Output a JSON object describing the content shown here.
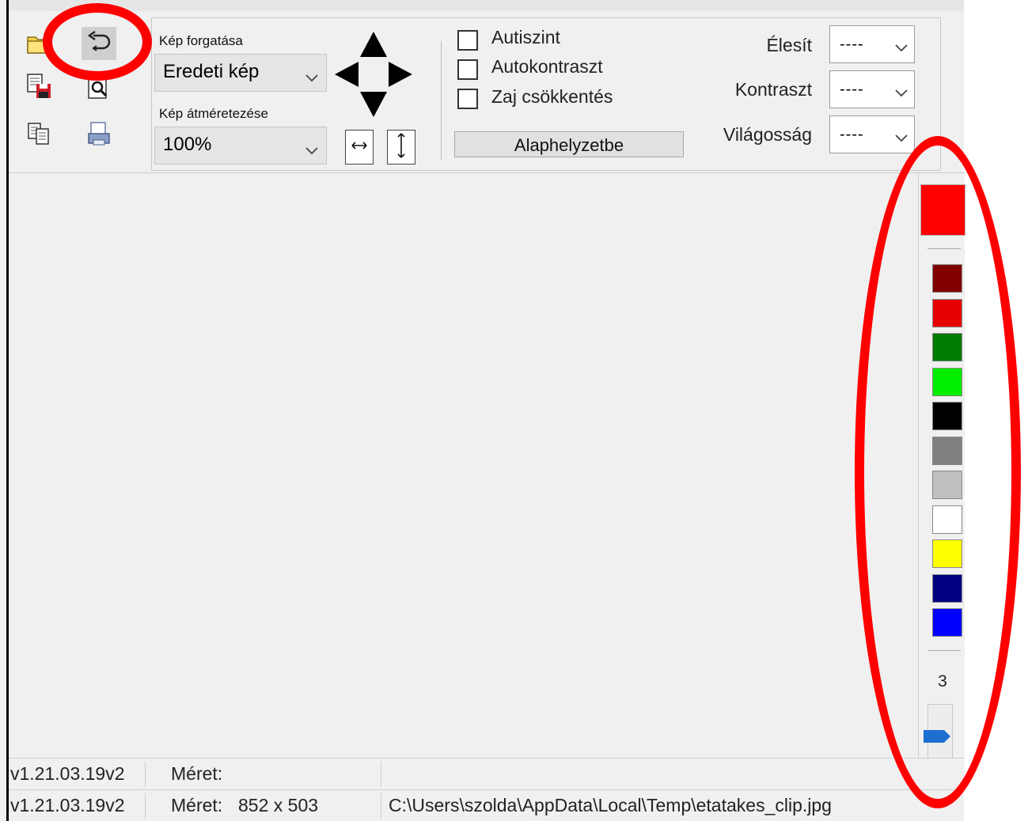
{
  "toolbar": {
    "rotate_label": "Kép forgatása",
    "rotate_value": "Eredeti kép",
    "resize_label": "Kép átméretezése",
    "resize_value": "100%",
    "checkboxes": [
      {
        "label": "Autiszint",
        "checked": false
      },
      {
        "label": "Autokontraszt",
        "checked": false
      },
      {
        "label": "Zaj csökkentés",
        "checked": false
      }
    ],
    "reset_label": "Alaphelyzetbe",
    "adjustments": [
      {
        "label": "Élesít",
        "value": "----"
      },
      {
        "label": "Kontraszt",
        "value": "----"
      },
      {
        "label": "Világosság",
        "value": "----"
      }
    ]
  },
  "palette": {
    "selected_color": "#ff0000",
    "colors": [
      "#800000",
      "#e60000",
      "#007a00",
      "#00ee00",
      "#000000",
      "#808080",
      "#c0c0c0",
      "#ffffff",
      "#ffff00",
      "#000080",
      "#0000ff"
    ],
    "pen_size": "3"
  },
  "status": {
    "row1": {
      "version": "v1.21.03.19v2",
      "size_label": "Méret:"
    },
    "row2": {
      "version": "v1.21.03.19v2",
      "size_label": "Méret:",
      "size_value": "852 x 503",
      "path": "C:\\Users\\szolda\\AppData\\Local\\Temp\\etatakes_clip.jpg"
    }
  },
  "annotation_color": "#ff0000"
}
